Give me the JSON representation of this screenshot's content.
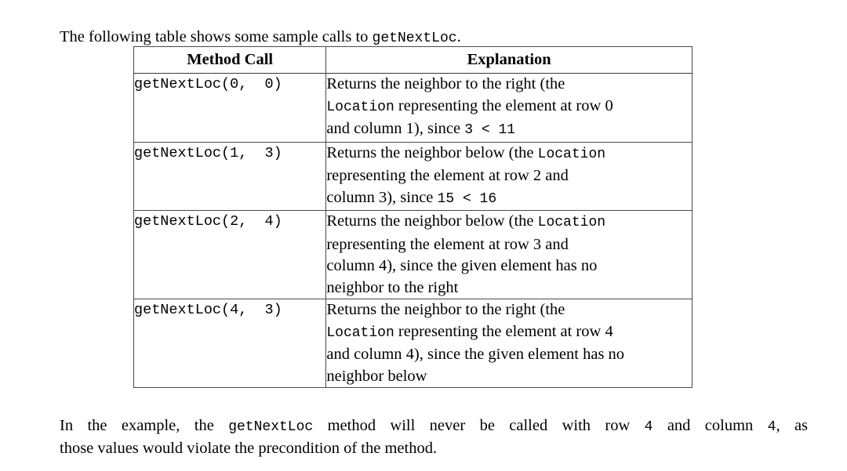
{
  "intro": {
    "before": "The following table shows some sample calls to ",
    "method": "getNextLoc",
    "after": "."
  },
  "table": {
    "headers": {
      "call": "Method Call",
      "explanation": "Explanation"
    },
    "rows": [
      {
        "call": "getNextLoc(0,  0)",
        "explanation_lines": [
          {
            "parts": [
              {
                "text": "Returns the neighbor to the right (the",
                "mono": false
              }
            ]
          },
          {
            "parts": [
              {
                "text": "Location",
                "mono": true
              },
              {
                "text": " representing the element at row 0",
                "mono": false
              }
            ]
          },
          {
            "parts": [
              {
                "text": "and column 1), since ",
                "mono": false
              },
              {
                "text": "3 < 11",
                "mono": true
              }
            ]
          }
        ]
      },
      {
        "call": "getNextLoc(1,  3)",
        "explanation_lines": [
          {
            "parts": [
              {
                "text": "Returns the neighbor below (the ",
                "mono": false
              },
              {
                "text": "Location",
                "mono": true
              }
            ]
          },
          {
            "parts": [
              {
                "text": "representing the element at row 2 and",
                "mono": false
              }
            ]
          },
          {
            "parts": [
              {
                "text": "column 3), since ",
                "mono": false
              },
              {
                "text": "15 < 16",
                "mono": true
              }
            ]
          }
        ]
      },
      {
        "call": "getNextLoc(2,  4)",
        "explanation_lines": [
          {
            "parts": [
              {
                "text": "Returns the neighbor below (the ",
                "mono": false
              },
              {
                "text": "Location",
                "mono": true
              }
            ]
          },
          {
            "parts": [
              {
                "text": "representing the element at row 3 and",
                "mono": false
              }
            ]
          },
          {
            "parts": [
              {
                "text": "column 4), since the given element has no",
                "mono": false
              }
            ]
          },
          {
            "parts": [
              {
                "text": "neighbor to the right",
                "mono": false
              }
            ]
          }
        ]
      },
      {
        "call": "getNextLoc(4,  3)",
        "explanation_lines": [
          {
            "parts": [
              {
                "text": "Returns the neighbor to the right (the",
                "mono": false
              }
            ]
          },
          {
            "parts": [
              {
                "text": "Location",
                "mono": true
              },
              {
                "text": " representing the element at row 4",
                "mono": false
              }
            ]
          },
          {
            "parts": [
              {
                "text": "and column 4), since the given element has no",
                "mono": false
              }
            ]
          },
          {
            "parts": [
              {
                "text": "neighbor below",
                "mono": false
              }
            ]
          }
        ]
      }
    ]
  },
  "closing": {
    "line1_parts": [
      {
        "text": "In the example, the ",
        "mono": false
      },
      {
        "text": "getNextLoc",
        "mono": true
      },
      {
        "text": " method will never be called with row ",
        "mono": false
      },
      {
        "text": "4",
        "mono": true
      },
      {
        "text": " and column ",
        "mono": false
      },
      {
        "text": "4",
        "mono": true
      },
      {
        "text": ", as",
        "mono": false
      }
    ],
    "line2": "those values would violate the precondition of the method."
  },
  "colors": {
    "text": "#000000",
    "border": "#4a4a4a",
    "background": "#ffffff"
  }
}
